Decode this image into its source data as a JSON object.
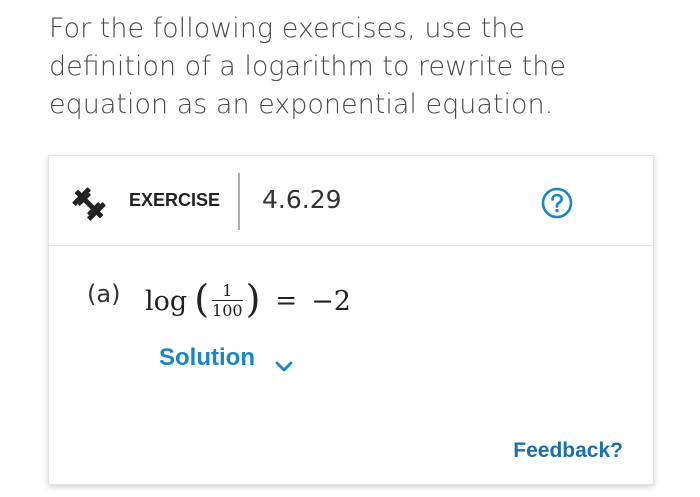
{
  "intro": {
    "text": "For the following exercises, use the definition of a logarithm to rewrite the equation as an exponential equation."
  },
  "exercise": {
    "label": "EXERCISE",
    "number": "4.6.29",
    "icon": "dumbbell-icon",
    "help_icon": "question-circle-icon"
  },
  "problem": {
    "part": "(a)",
    "log": "log",
    "paren_open": "(",
    "frac_num": "1",
    "frac_den": "100",
    "paren_close": ")",
    "equals": "=",
    "rhs": "−2"
  },
  "solution": {
    "label": "Solution",
    "icon": "chevron-down-icon"
  },
  "feedback": {
    "label": "Feedback?"
  },
  "colors": {
    "accent": "#1a86c6",
    "feedback": "#1a6fb0",
    "text": "#4a4a4a"
  }
}
